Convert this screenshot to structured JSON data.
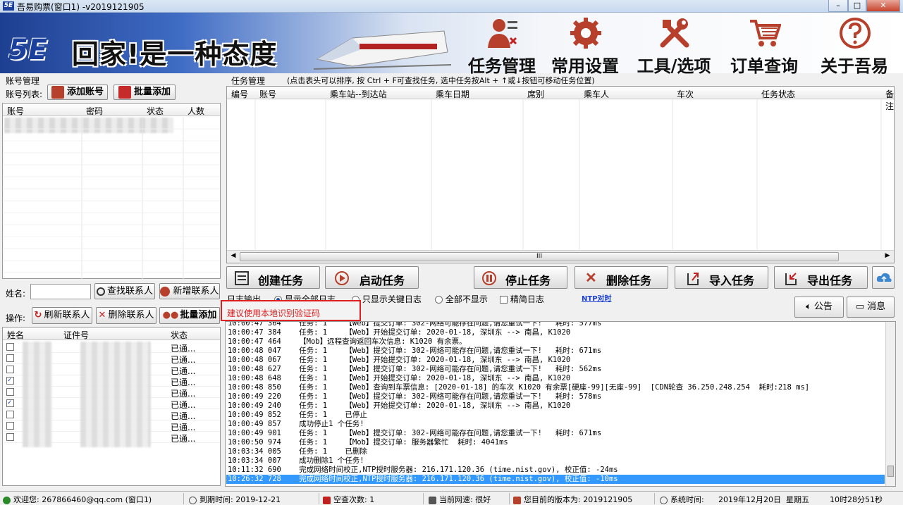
{
  "window": {
    "logo_text": "5E",
    "title": "吾易购票(窗口1)   -v2019121905",
    "min": "–",
    "max": "□",
    "close": "✕"
  },
  "banner": {
    "logo": "5E",
    "slogan": "回家!是一种态度",
    "nav": [
      {
        "label": "任务管理"
      },
      {
        "label": "常用设置"
      },
      {
        "label": "工具/选项"
      },
      {
        "label": "订单查询"
      },
      {
        "label": "关于吾易"
      }
    ]
  },
  "accounts": {
    "group_title": "账号管理",
    "list_label": "账号列表:",
    "add_button": "添加账号",
    "batch_add_button": "批量添加",
    "columns": [
      "账号",
      "密码",
      "状态",
      "人数"
    ]
  },
  "contacts": {
    "name_label": "姓名:",
    "name_value": "",
    "find_button": "查找联系人",
    "new_button": "新增联系人",
    "op_label": "操作:",
    "refresh_button": "刷新联系人",
    "delete_button": "删除联系人",
    "batch_button": "批量添加",
    "columns": [
      "姓名",
      "证件号",
      "状态"
    ],
    "rows": [
      {
        "checked": false,
        "status": "已通..."
      },
      {
        "checked": false,
        "status": "已通..."
      },
      {
        "checked": false,
        "status": "已通..."
      },
      {
        "checked": true,
        "status": "已通..."
      },
      {
        "checked": false,
        "status": "已通..."
      },
      {
        "checked": true,
        "status": "已通..."
      },
      {
        "checked": false,
        "status": "已通..."
      },
      {
        "checked": false,
        "status": "已通..."
      },
      {
        "checked": false,
        "status": "已通..."
      }
    ]
  },
  "tasks": {
    "group_title": "任务管理",
    "hint": "(点击表头可以排序, 按 Ctrl + F可查找任务, 选中任务按Alt + ↑或↓按钮可移动任务位置)",
    "columns": [
      "编号",
      "账号",
      "乘车站--到达站",
      "乘车日期",
      "席别",
      "乘车人",
      "车次",
      "任务状态",
      "备注"
    ],
    "scroll_grip": "III",
    "buttons": {
      "create": "创建任务",
      "start": "启动任务",
      "stop": "停止任务",
      "delete": "删除任务",
      "import": "导入任务",
      "export": "导出任务"
    }
  },
  "log": {
    "label": "日志输出",
    "opt_all": "显示全部日志",
    "opt_key": "只显示关键日志",
    "opt_none": "全部不显示",
    "opt_brief": "精简日志",
    "ntp_link": "NTP对时",
    "announce_button": "公告",
    "message_button": "消息",
    "warning": "建议使用本地识别验证码",
    "lines": [
      "10:00:47 364    任务: 1    【Web】提交订单: 302-网络可能存在问题,请您重试一下!   耗时: 577ms",
      "10:00:47 384    任务: 1    【Web】开始提交订单: 2020-01-18, 深圳东 --> 南昌, K1020",
      "10:00:47 464    【Mob】远程查询返回车次信息: K1020 有余票。",
      "10:00:48 047    任务: 1    【Web】提交订单: 302-网络可能存在问题,请您重试一下!   耗时: 671ms",
      "10:00:48 067    任务: 1    【Web】开始提交订单: 2020-01-18, 深圳东 --> 南昌, K1020",
      "10:00:48 627    任务: 1    【Web】提交订单: 302-网络可能存在问题,请您重试一下!   耗时: 562ms",
      "10:00:48 648    任务: 1    【Web】开始提交订单: 2020-01-18, 深圳东 --> 南昌, K1020",
      "10:00:48 850    任务: 1    【Web】查询到车票信息: [2020-01-18] 的车次 K1020 有余票[硬座-99][无座-99]  [CDN轮查 36.250.248.254  耗时:218 ms]",
      "10:00:49 220    任务: 1    【Web】提交订单: 302-网络可能存在问题,请您重试一下!   耗时: 578ms",
      "10:00:49 240    任务: 1    【Web】开始提交订单: 2020-01-18, 深圳东 --> 南昌, K1020",
      "10:00:49 852    任务: 1    已停止",
      "10:00:49 857    成功停止1 个任务!",
      "10:00:49 901    任务: 1    【Web】提交订单: 302-网络可能存在问题,请您重试一下!   耗时: 671ms",
      "10:00:50 974    任务: 1    【Mob】提交订单: 服务器繁忙  耗时: 4041ms",
      "10:03:34 005    任务: 1    已删除",
      "10:03:34 007    成功删除1 个任务!",
      "10:11:32 690    完成网络时间校正,NTP授时服务器: 216.171.120.36 (time.nist.gov), 校正值: -24ms",
      "10:26:32 728    完成网络时间校正,NTP授时服务器: 216.171.120.36 (time.nist.gov), 校正值: -10ms"
    ]
  },
  "status": {
    "welcome": "欢迎您: 267866460@qq.com (窗口1)",
    "expire": "到期时间: 2019-12-21",
    "empty_checks": "空查次数: 1",
    "network": "当前网速: 很好",
    "version": "您目前的版本为: 2019121905",
    "sys_time_label": "系统时间:",
    "date": "2019年12月20日",
    "weekday": "星期五",
    "time": "10时28分51秒"
  },
  "colors": {
    "accent_blue": "#1b3f9c",
    "warning_red": "#e02020",
    "selection": "#3399ff"
  }
}
